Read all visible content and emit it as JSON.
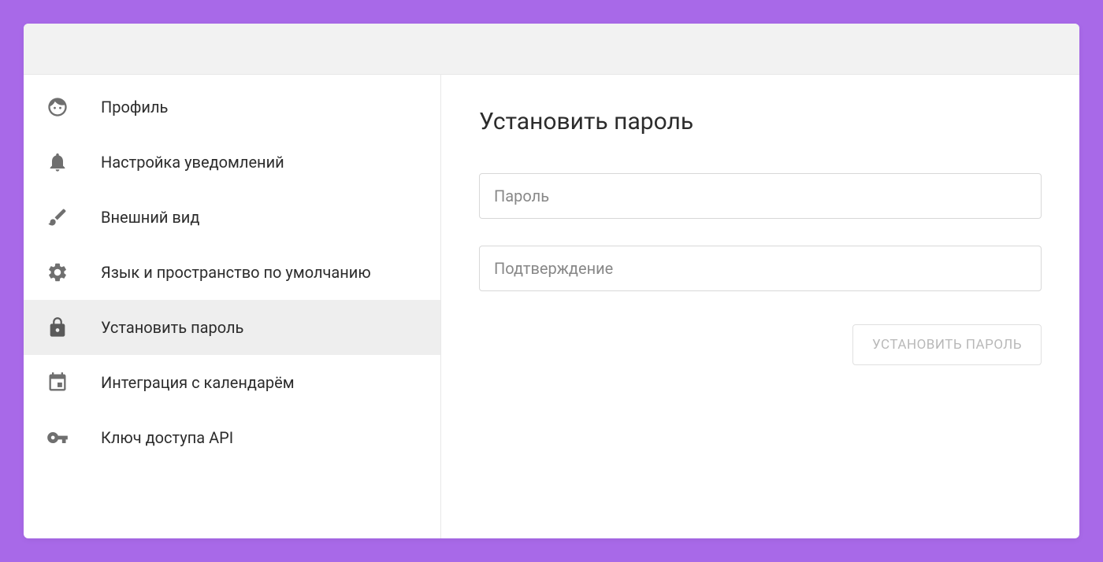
{
  "sidebar": {
    "items": [
      {
        "icon": "face",
        "label": "Профиль",
        "selected": false
      },
      {
        "icon": "bell",
        "label": "Настройка уведомлений",
        "selected": false
      },
      {
        "icon": "brush",
        "label": "Внешний вид",
        "selected": false
      },
      {
        "icon": "gear",
        "label": "Язык и пространство по умолчанию",
        "selected": false
      },
      {
        "icon": "lock",
        "label": "Установить пароль",
        "selected": true
      },
      {
        "icon": "calendar",
        "label": "Интеграция с календарём",
        "selected": false
      },
      {
        "icon": "key",
        "label": "Ключ доступа API",
        "selected": false
      }
    ]
  },
  "main": {
    "title": "Установить пароль",
    "password_placeholder": "Пароль",
    "confirm_placeholder": "Подтверждение",
    "submit_label": "УСТАНОВИТЬ ПАРОЛЬ"
  }
}
